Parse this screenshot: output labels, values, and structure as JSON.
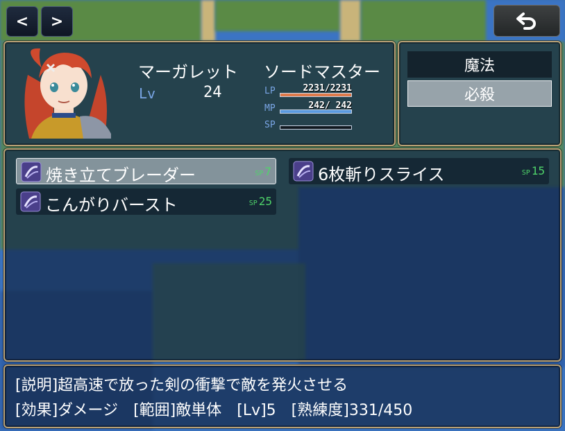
{
  "nav": {
    "prev_label": "<",
    "next_label": ">"
  },
  "actor": {
    "name": "マーガレット",
    "class": "ソードマスター",
    "level_label": "Lv",
    "level": "24",
    "lp": {
      "label": "LP",
      "current": "2231",
      "max": "2231",
      "display": "2231/2231",
      "fill": 1.0
    },
    "mp": {
      "label": "MP",
      "current": "242",
      "max": "242",
      "display": "242/ 242",
      "fill": 1.0
    },
    "sp": {
      "label": "SP",
      "fill": 0.0
    }
  },
  "skill_types": [
    {
      "label": "魔法"
    },
    {
      "label": "必殺",
      "selected": true
    }
  ],
  "skills": [
    {
      "name": "焼き立てブレーダー",
      "cost_unit": "SP",
      "cost": "7",
      "selected": true
    },
    {
      "name": "6枚斬りスライス",
      "cost_unit": "SP",
      "cost": "15"
    },
    {
      "name": "こんがりバースト",
      "cost_unit": "SP",
      "cost": "25"
    }
  ],
  "help": {
    "line1": "[説明]超高速で放った剣の衝撃で敵を発火させる",
    "line2": "[効果]ダメージ　[範囲]敵単体　[Lv]5　[熟練度]331/450"
  },
  "colors": {
    "frame": "#b8a074",
    "lp_gauge": "#e07a4a",
    "mp_gauge": "#5a9ae0",
    "sp_cost": "#4fd46a",
    "stat_label": "#7aa6e6"
  },
  "icons": {
    "back": "return-arrow-icon",
    "skill": "sword-slash-icon"
  }
}
